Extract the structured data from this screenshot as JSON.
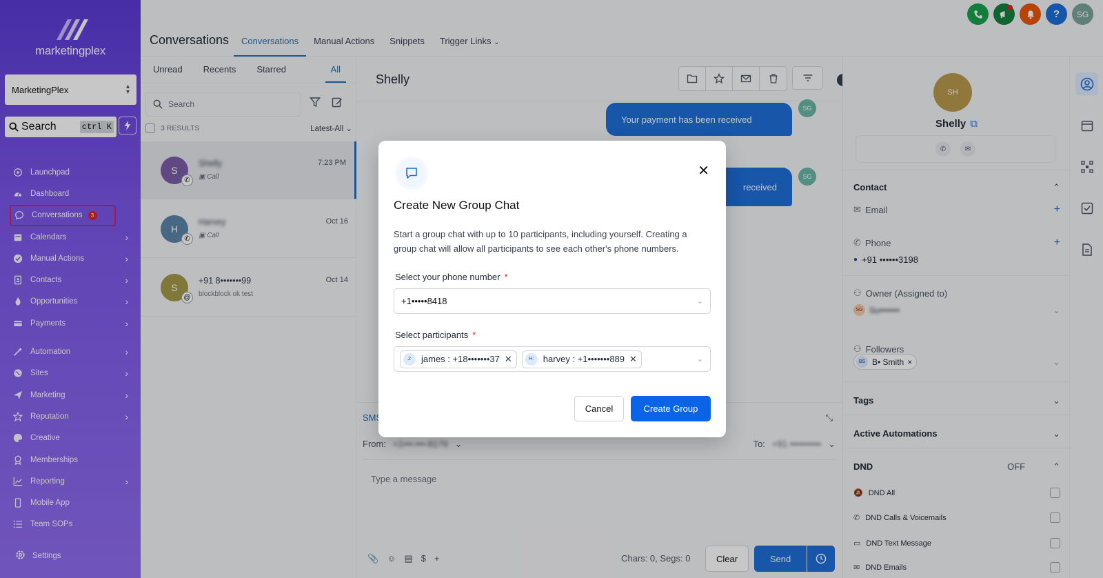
{
  "sidebar": {
    "brand": "marketingplex",
    "account": "MarketingPlex",
    "search_placeholder": "Search",
    "search_shortcut": "ctrl K",
    "items": [
      {
        "label": "Launchpad",
        "icon": "rocket-icon"
      },
      {
        "label": "Dashboard",
        "icon": "gauge-icon"
      },
      {
        "label": "Conversations",
        "icon": "chat-icon",
        "badge": "3"
      },
      {
        "label": "Calendars",
        "icon": "calendar-icon"
      },
      {
        "label": "Manual Actions",
        "icon": "check-circle-icon"
      },
      {
        "label": "Contacts",
        "icon": "contact-book-icon"
      },
      {
        "label": "Opportunities",
        "icon": "flame-icon"
      },
      {
        "label": "Payments",
        "icon": "card-icon"
      },
      {
        "label": "Automation",
        "icon": "wand-icon"
      },
      {
        "label": "Sites",
        "icon": "globe-icon"
      },
      {
        "label": "Marketing",
        "icon": "send-icon"
      },
      {
        "label": "Reputation",
        "icon": "star-icon"
      },
      {
        "label": "Creative",
        "icon": "palette-icon"
      },
      {
        "label": "Memberships",
        "icon": "award-icon"
      },
      {
        "label": "Reporting",
        "icon": "chart-icon"
      },
      {
        "label": "Mobile App",
        "icon": "phone-icon"
      },
      {
        "label": "Team SOPs",
        "icon": "list-icon"
      }
    ],
    "settings": "Settings"
  },
  "header": {
    "title": "Conversations",
    "tabs": [
      "Conversations",
      "Manual Actions",
      "Snippets",
      "Trigger Links"
    ],
    "user_initials": "SG"
  },
  "list": {
    "filters": [
      "Unread",
      "Recents",
      "Starred",
      "All"
    ],
    "search_placeholder": "Search",
    "results": "3 RESULTS",
    "sort": "Latest-All",
    "conversations": [
      {
        "initial": "S",
        "name": "Shelly",
        "sub": "Call",
        "time": "7:23 PM",
        "color": "#7b5ea7"
      },
      {
        "initial": "H",
        "name": "Harvey",
        "sub": "Call",
        "time": "Oct 16",
        "color": "#5b84a8"
      },
      {
        "initial": "S",
        "name": "+91 8•••••••99",
        "sub": "blockblock ok test",
        "time": "Oct 14",
        "color": "#a39a4a"
      }
    ]
  },
  "chat": {
    "contact_name": "Shelly",
    "messages": [
      "Your payment has been received",
      "received"
    ],
    "avatar_initials": "SG",
    "composer": {
      "tab": "SMS",
      "from_label": "From:",
      "from_value": "+1•••-•••-8179",
      "to_label": "To:",
      "to_value": "+91 ••••••••••",
      "placeholder": "Type a message",
      "chars": "Chars: 0, Segs: 0",
      "clear": "Clear",
      "send": "Send"
    }
  },
  "contact": {
    "initials": "SH",
    "name": "Shelly",
    "contact_section": "Contact",
    "email_label": "Email",
    "phone_label": "Phone",
    "phone_value": "+91 ••••••3198",
    "owner_label": "Owner (Assigned to)",
    "owner_initials": "SG",
    "owner_value": "Su•••••••",
    "followers_label": "Followers",
    "follower_initials": "BS",
    "follower_value": "B• Smith",
    "tags": "Tags",
    "active_automations": "Active Automations",
    "dnd": "DND",
    "dnd_status": "OFF",
    "dnd_items": [
      "DND All",
      "DND Calls & Voicemails",
      "DND Text Message",
      "DND Emails"
    ]
  },
  "modal": {
    "title": "Create New Group Chat",
    "description": "Start a group chat with up to 10 participants, including yourself. Creating a group chat will allow all participants to see each other's phone numbers.",
    "phone_label": "Select your phone number",
    "phone_value": "+1•••••8418",
    "participants_label": "Select participants",
    "participants": [
      {
        "initials": "J:",
        "label": "james : +18•••••••37"
      },
      {
        "initials": "H:",
        "label": "harvey : +1•••••••889"
      }
    ],
    "required_mark": "*",
    "cancel": "Cancel",
    "create": "Create Group"
  },
  "colors": {
    "accent": "#1e6fd9",
    "sidebar_top": "#5b3bd6",
    "sidebar_bottom": "#8f6df0",
    "badge": "#dc2626"
  }
}
